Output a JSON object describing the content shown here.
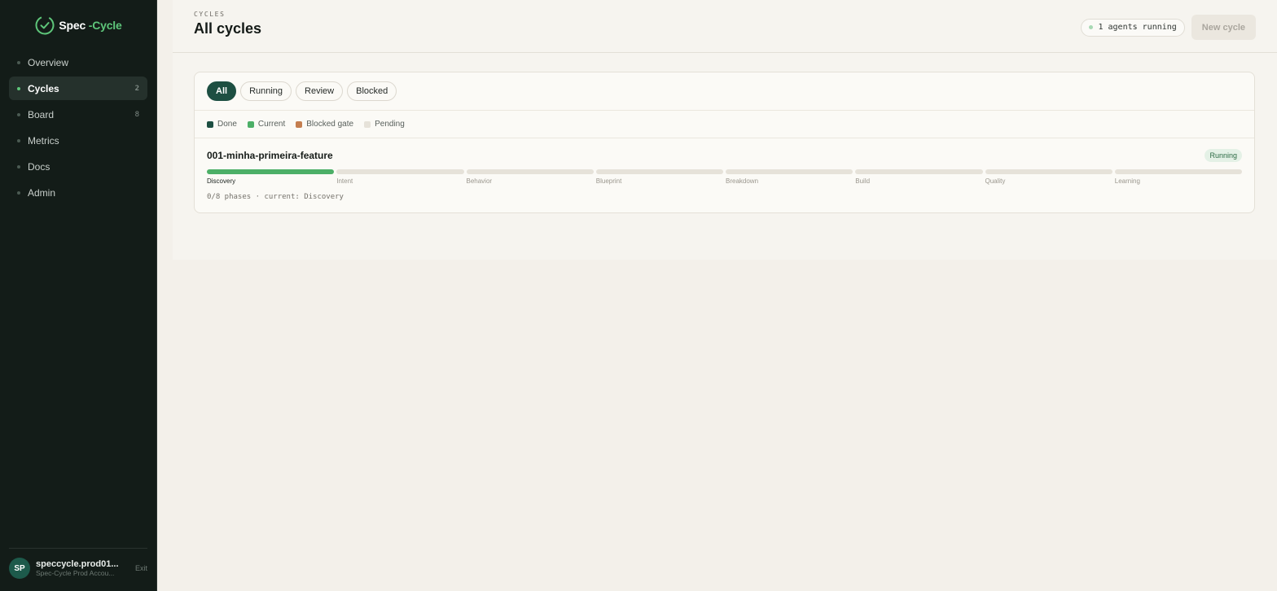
{
  "brand": {
    "name_main": "Spec",
    "name_accent": "-Cycle",
    "icon": "check-circle-icon",
    "accent_color": "#5ec67a"
  },
  "sidebar": {
    "items": [
      {
        "label": "Overview",
        "count": ""
      },
      {
        "label": "Cycles",
        "count": "2"
      },
      {
        "label": "Board",
        "count": "8"
      },
      {
        "label": "Metrics",
        "count": ""
      },
      {
        "label": "Docs",
        "count": ""
      },
      {
        "label": "Admin",
        "count": ""
      }
    ],
    "active": "Cycles"
  },
  "user": {
    "initials": "SP",
    "name": "speccycle.prod01...",
    "org": "Spec-Cycle Prod Accou...",
    "exit_label": "Exit"
  },
  "header": {
    "eyebrow": "CYCLES",
    "title": "All cycles",
    "agents_status": "1 agents running",
    "new_cycle_label": "New cycle"
  },
  "filters": {
    "options": [
      "All",
      "Running",
      "Review",
      "Blocked"
    ],
    "selected": "All"
  },
  "legend": [
    {
      "label": "Done",
      "color": "#1d4f42"
    },
    {
      "label": "Current",
      "color": "#4caf67"
    },
    {
      "label": "Blocked gate",
      "color": "#c47e4f"
    },
    {
      "label": "Pending",
      "color": "#e6e2d9"
    }
  ],
  "cycles": [
    {
      "name": "001-minha-primeira-feature",
      "status": "Running",
      "phases": [
        "Discovery",
        "Intent",
        "Behavior",
        "Blueprint",
        "Breakdown",
        "Build",
        "Quality",
        "Learning"
      ],
      "current_phase": "Discovery",
      "summary": "0/8 phases · current: Discovery"
    }
  ]
}
